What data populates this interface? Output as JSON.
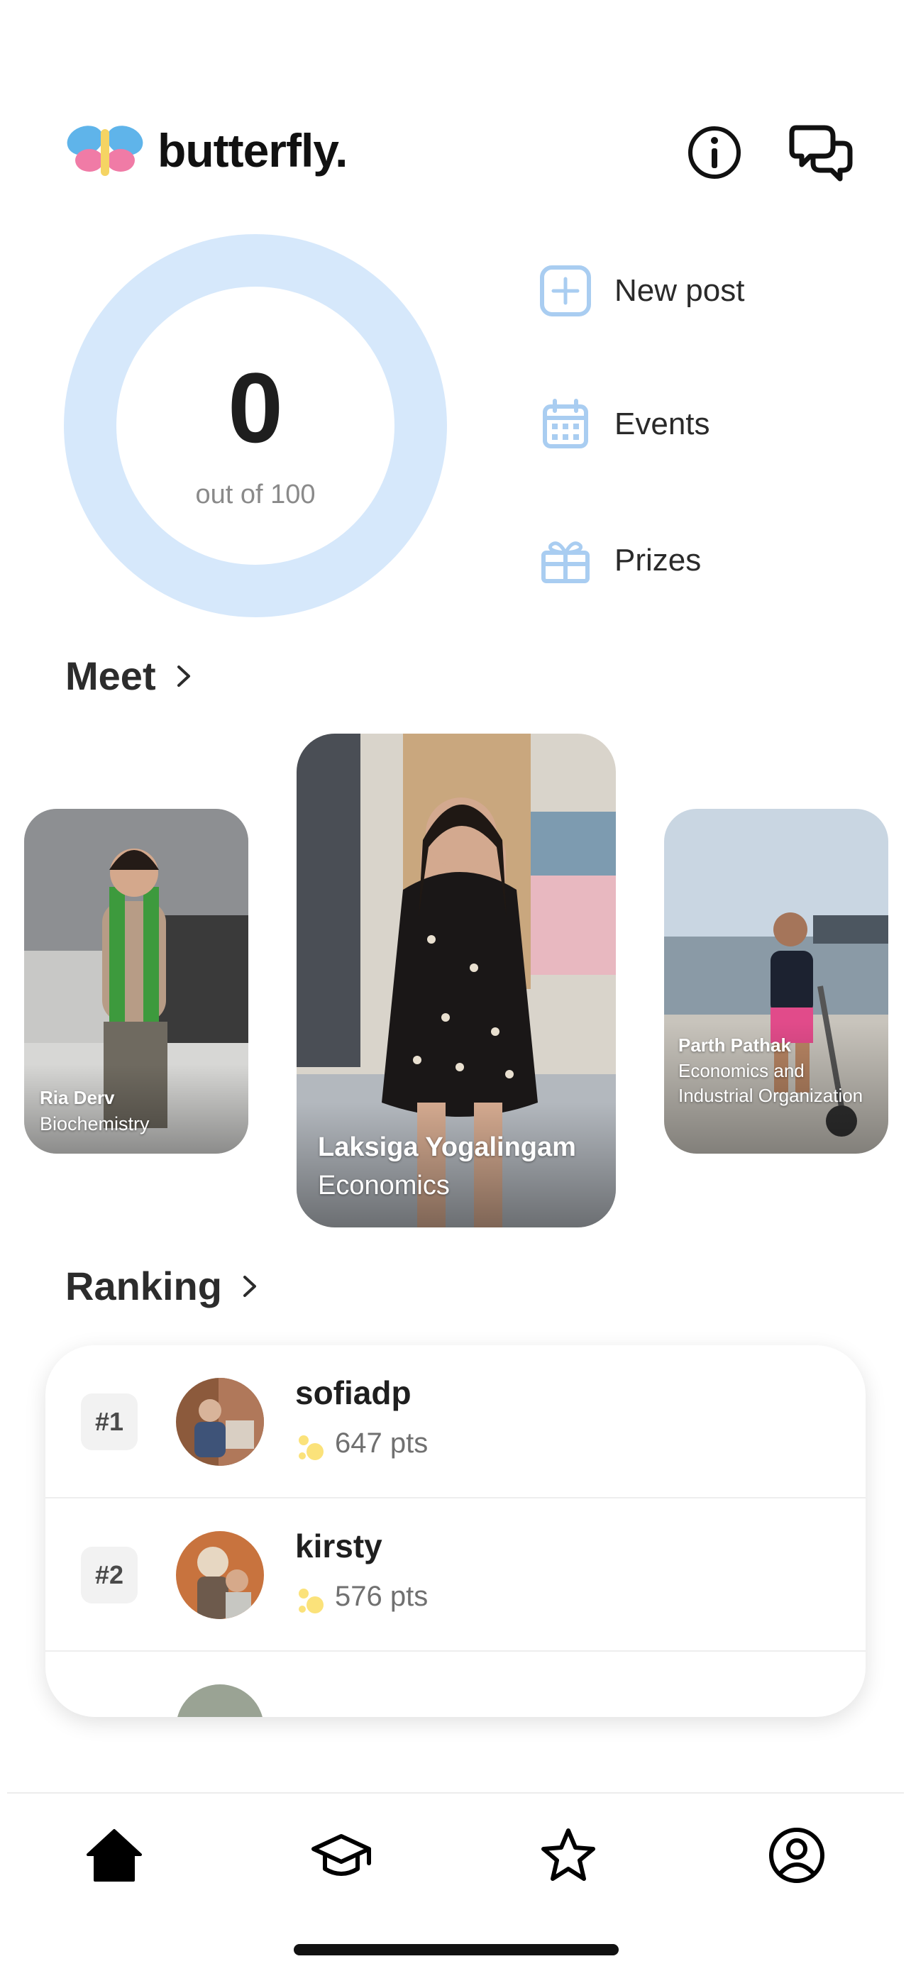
{
  "brand": {
    "name": "butterfly."
  },
  "score": {
    "value": "0",
    "caption": "out of 100",
    "progress": 0,
    "ring_color": "#d6e8fb"
  },
  "actions": [
    {
      "label": "New post",
      "icon": "plus-square-icon"
    },
    {
      "label": "Events",
      "icon": "calendar-icon"
    },
    {
      "label": "Prizes",
      "icon": "gift-icon"
    }
  ],
  "meet": {
    "title": "Meet",
    "cards": [
      {
        "name": "Ria Derv",
        "subject": "Biochemistry"
      },
      {
        "name": "Laksiga Yogalingam",
        "subject": "Economics"
      },
      {
        "name": "Parth Pathak",
        "subject": "Economics and Industrial Organization"
      }
    ]
  },
  "ranking": {
    "title": "Ranking",
    "rows": [
      {
        "rank": "#1",
        "username": "sofiadp",
        "points": "647 pts"
      },
      {
        "rank": "#2",
        "username": "kirsty",
        "points": "576 pts"
      }
    ]
  },
  "nav": [
    "home-icon",
    "graduation-cap-icon",
    "star-icon",
    "profile-icon"
  ],
  "colors": {
    "accent_light": "#d6e8fb",
    "icon_blue": "#a9cdf1",
    "text_dark": "#1a1a1a"
  }
}
